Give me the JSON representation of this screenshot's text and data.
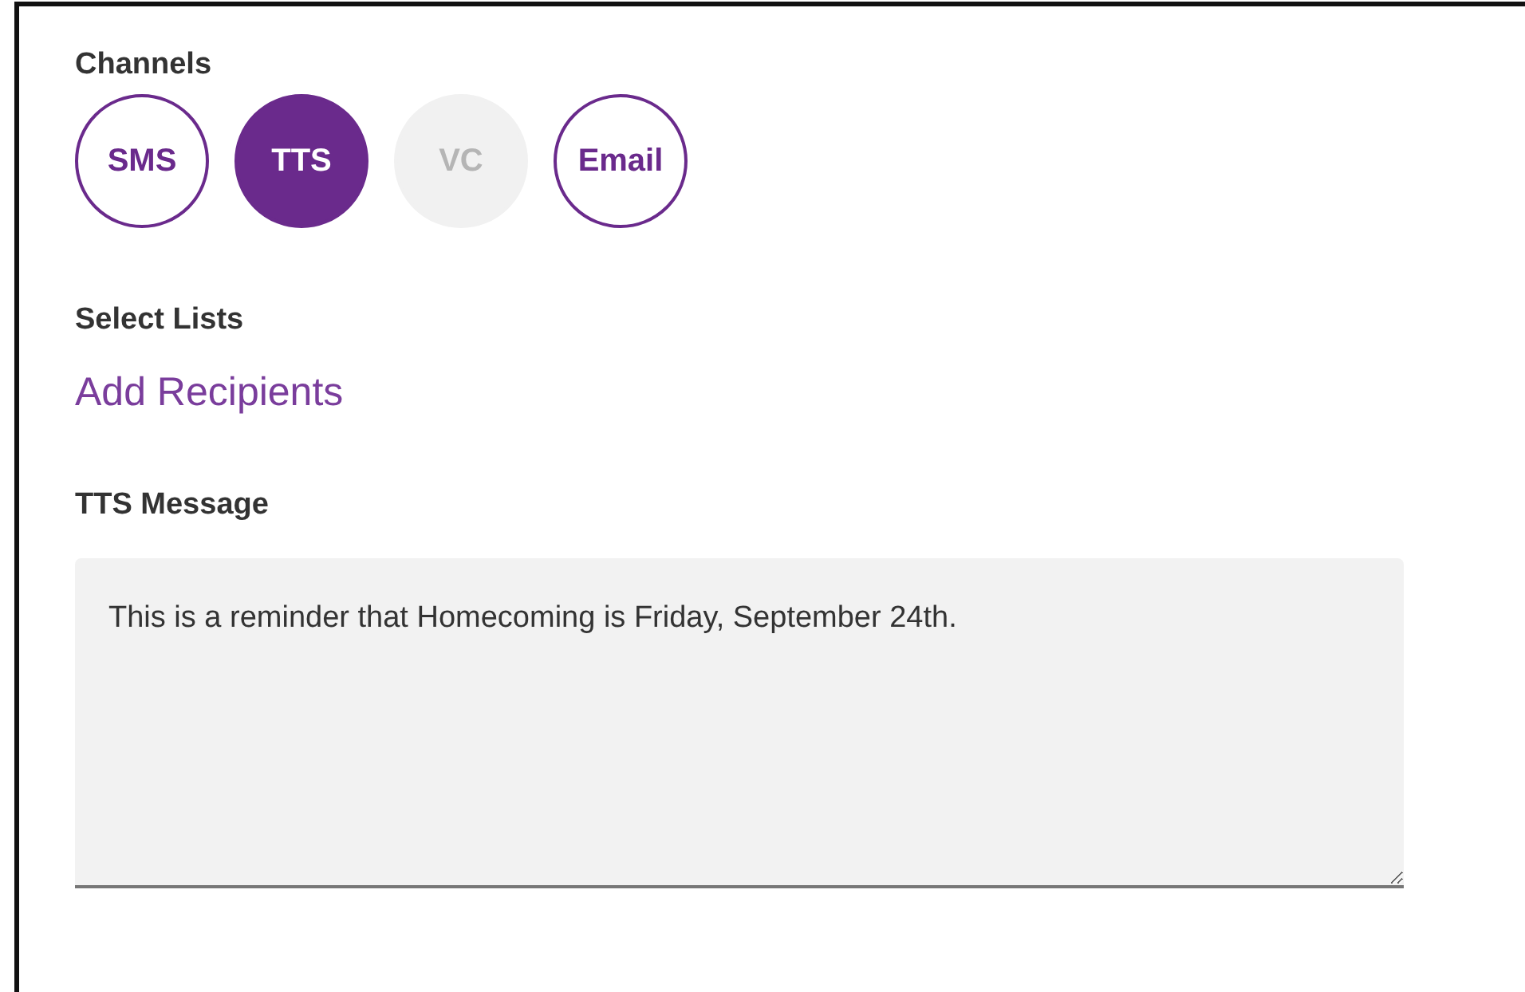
{
  "channels": {
    "label": "Channels",
    "items": [
      {
        "label": "SMS",
        "selected": false,
        "disabled": false
      },
      {
        "label": "TTS",
        "selected": true,
        "disabled": false
      },
      {
        "label": "VC",
        "selected": false,
        "disabled": true
      },
      {
        "label": "Email",
        "selected": false,
        "disabled": false
      }
    ]
  },
  "lists": {
    "label": "Select Lists",
    "link": "Add Recipients"
  },
  "message": {
    "label": "TTS Message",
    "value": "This is a reminder that Homecoming is Friday, September 24th."
  }
}
